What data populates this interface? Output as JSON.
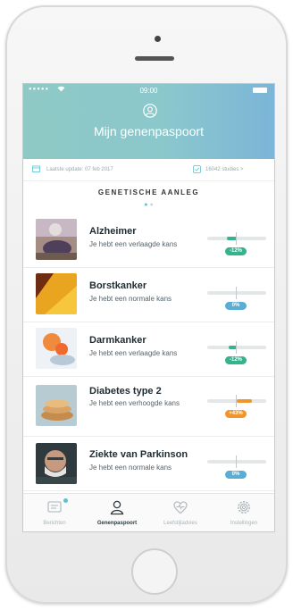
{
  "status_bar": {
    "signal": "●●●●● ",
    "time": "09:00"
  },
  "header": {
    "title": "Mijn genenpaspoort"
  },
  "info_bar": {
    "last_update": "Laatste update: 07 feb 2017",
    "studies": "16042 studies >"
  },
  "section": {
    "title": "GENETISCHE AANLEG"
  },
  "conditions": [
    {
      "name": "Alzheimer",
      "risk": "Je hebt een verlaagde kans",
      "badge": "-12%",
      "level": "decreased",
      "color": "#35b28e"
    },
    {
      "name": "Borstkanker",
      "risk": "Je hebt een normale kans",
      "badge": "0%",
      "level": "normal",
      "color": "#5aaed4"
    },
    {
      "name": "Darmkanker",
      "risk": "Je hebt een verlaagde kans",
      "badge": "-12%",
      "level": "decreased",
      "color": "#35b28e"
    },
    {
      "name": "Diabetes type 2",
      "risk": "Je hebt een verhoogde kans",
      "badge": "+43%",
      "level": "increased",
      "color": "#f0962a"
    },
    {
      "name": "Ziekte van Parkinson",
      "risk": "Je hebt een normale kans",
      "badge": "0%",
      "level": "normal",
      "color": "#5aaed4"
    }
  ],
  "tabs": [
    {
      "label": "Berichten",
      "icon": "message-icon",
      "active": false
    },
    {
      "label": "Genenpaspoort",
      "icon": "person-icon",
      "active": true
    },
    {
      "label": "Leefstijladvies",
      "icon": "heart-icon",
      "active": false
    },
    {
      "label": "Instellingen",
      "icon": "gear-icon",
      "active": false
    }
  ]
}
